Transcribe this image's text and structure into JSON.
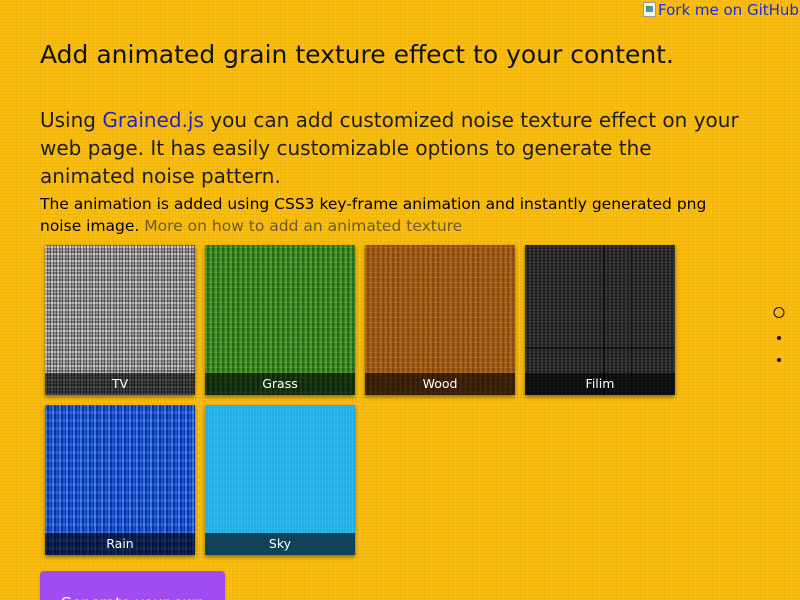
{
  "fork_ribbon": {
    "alt_text": "Fork me on GitHub",
    "icon": "broken-image-icon"
  },
  "header": {
    "title": "Add animated grain texture effect to your content."
  },
  "intro": {
    "prefix": "Using ",
    "link_text": "Grained.js",
    "suffix": " you can add customized noise texture effect on your web page. It has easily customizable options to generate the animated noise pattern."
  },
  "note": {
    "text": "The animation is added using CSS3 key-frame animation and instantly generated png noise image. ",
    "link_text": "More on how to add an animated texture"
  },
  "presets": [
    {
      "label": "TV",
      "color": "#8c8c8c"
    },
    {
      "label": "Grass",
      "color": "#3d8a26"
    },
    {
      "label": "Wood",
      "color": "#a8611b"
    },
    {
      "label": "Filim",
      "color": "#262626"
    },
    {
      "label": "Rain",
      "color": "#1a54d8"
    },
    {
      "label": "Sky",
      "color": "#1eb6ee"
    }
  ],
  "pager": {
    "count": 3,
    "active_index": 0
  },
  "cta": {
    "label": "Generate your own"
  },
  "colors": {
    "background": "#fcbd0b",
    "link": "#2525c2",
    "button": "#a04cf0"
  }
}
